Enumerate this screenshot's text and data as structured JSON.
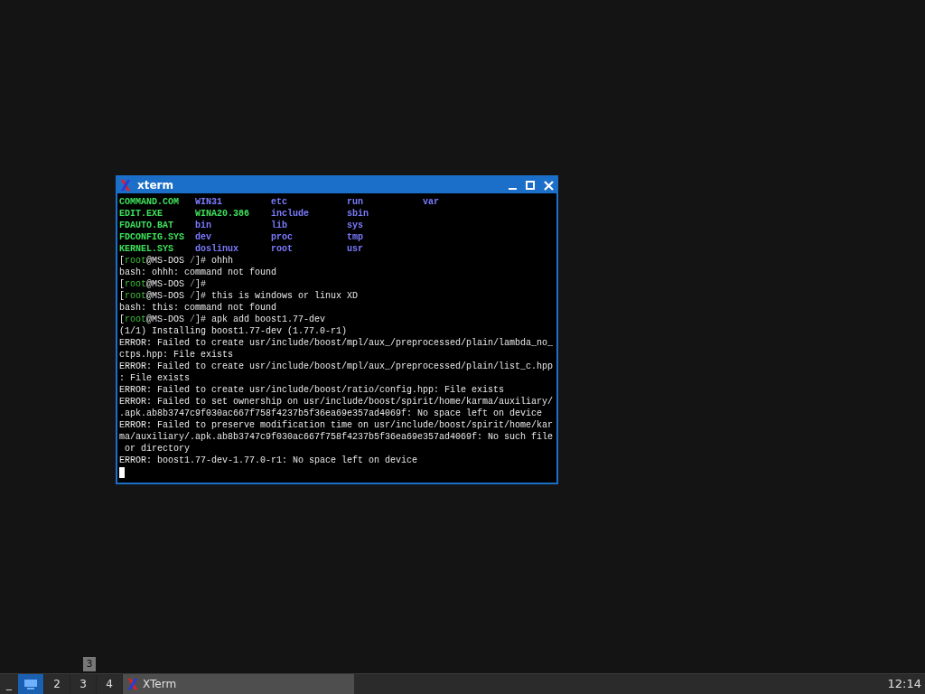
{
  "window": {
    "title": "xterm"
  },
  "terminal": {
    "listing": [
      [
        {
          "text": "COMMAND.COM",
          "kind": "file"
        },
        {
          "text": "WIN31",
          "kind": "dir"
        },
        {
          "text": "etc",
          "kind": "dir"
        },
        {
          "text": "run",
          "kind": "dir"
        },
        {
          "text": "var",
          "kind": "dir"
        }
      ],
      [
        {
          "text": "EDIT.EXE",
          "kind": "file"
        },
        {
          "text": "WINA20.386",
          "kind": "file"
        },
        {
          "text": "include",
          "kind": "dir"
        },
        {
          "text": "sbin",
          "kind": "dir"
        }
      ],
      [
        {
          "text": "FDAUTO.BAT",
          "kind": "file"
        },
        {
          "text": "bin",
          "kind": "dir"
        },
        {
          "text": "lib",
          "kind": "dir"
        },
        {
          "text": "sys",
          "kind": "dir"
        }
      ],
      [
        {
          "text": "FDCONFIG.SYS",
          "kind": "file"
        },
        {
          "text": "dev",
          "kind": "dir"
        },
        {
          "text": "proc",
          "kind": "dir"
        },
        {
          "text": "tmp",
          "kind": "dir"
        }
      ],
      [
        {
          "text": "KERNEL.SYS",
          "kind": "file"
        },
        {
          "text": "doslinux",
          "kind": "dir"
        },
        {
          "text": "root",
          "kind": "dir"
        },
        {
          "text": "usr",
          "kind": "dir"
        }
      ]
    ],
    "lines": [
      {
        "kind": "prompt",
        "open": "[",
        "user": "root",
        "host": "@MS-DOS",
        "path": "/",
        "close": "]#",
        "command": "ohhh"
      },
      {
        "kind": "output",
        "text": "bash: ohhh: command not found"
      },
      {
        "kind": "prompt",
        "open": "[",
        "user": "root",
        "host": "@MS-DOS",
        "path": "/",
        "close": "]#"
      },
      {
        "kind": "prompt",
        "open": "[",
        "user": "root",
        "host": "@MS-DOS",
        "path": "/",
        "close": "]#",
        "command": "this is windows or linux XD"
      },
      {
        "kind": "output",
        "text": "bash: this: command not found"
      },
      {
        "kind": "prompt",
        "open": "[",
        "user": "root",
        "host": "@MS-DOS",
        "path": "/",
        "close": "]#",
        "command": "apk add boost1.77-dev"
      },
      {
        "kind": "output",
        "text": "(1/1) Installing boost1.77-dev (1.77.0-r1)"
      },
      {
        "kind": "output",
        "text": "ERROR: Failed to create usr/include/boost/mpl/aux_/preprocessed/plain/lambda_no_"
      },
      {
        "kind": "output",
        "text": "ctps.hpp: File exists"
      },
      {
        "kind": "output",
        "text": "ERROR: Failed to create usr/include/boost/mpl/aux_/preprocessed/plain/list_c.hpp"
      },
      {
        "kind": "output",
        "text": ": File exists"
      },
      {
        "kind": "output",
        "text": "ERROR: Failed to create usr/include/boost/ratio/config.hpp: File exists"
      },
      {
        "kind": "output",
        "text": "ERROR: Failed to set ownership on usr/include/boost/spirit/home/karma/auxiliary/"
      },
      {
        "kind": "output",
        "text": ".apk.ab8b3747c9f030ac667f758f4237b5f36ea69e357ad4069f: No space left on device"
      },
      {
        "kind": "output",
        "text": "ERROR: Failed to preserve modification time on usr/include/boost/spirit/home/kar"
      },
      {
        "kind": "output",
        "text": "ma/auxiliary/.apk.ab8b3747c9f030ac667f758f4237b5f36ea69e357ad4069f: No such file"
      },
      {
        "kind": "output",
        "text": " or directory"
      },
      {
        "kind": "output",
        "text": "ERROR: boost1.77-dev-1.77.0-r1: No space left on device"
      },
      {
        "kind": "cursor"
      }
    ]
  },
  "taskbar": {
    "show_desktop": "_",
    "workspaces": [
      {
        "selected": true
      },
      {
        "label": "2",
        "selected": false
      },
      {
        "label": "3",
        "selected": false
      },
      {
        "label": "4",
        "selected": false
      }
    ],
    "tooltip": "3",
    "tasks": [
      {
        "label": "XTerm",
        "selected": true
      }
    ],
    "clock": "12:14"
  }
}
